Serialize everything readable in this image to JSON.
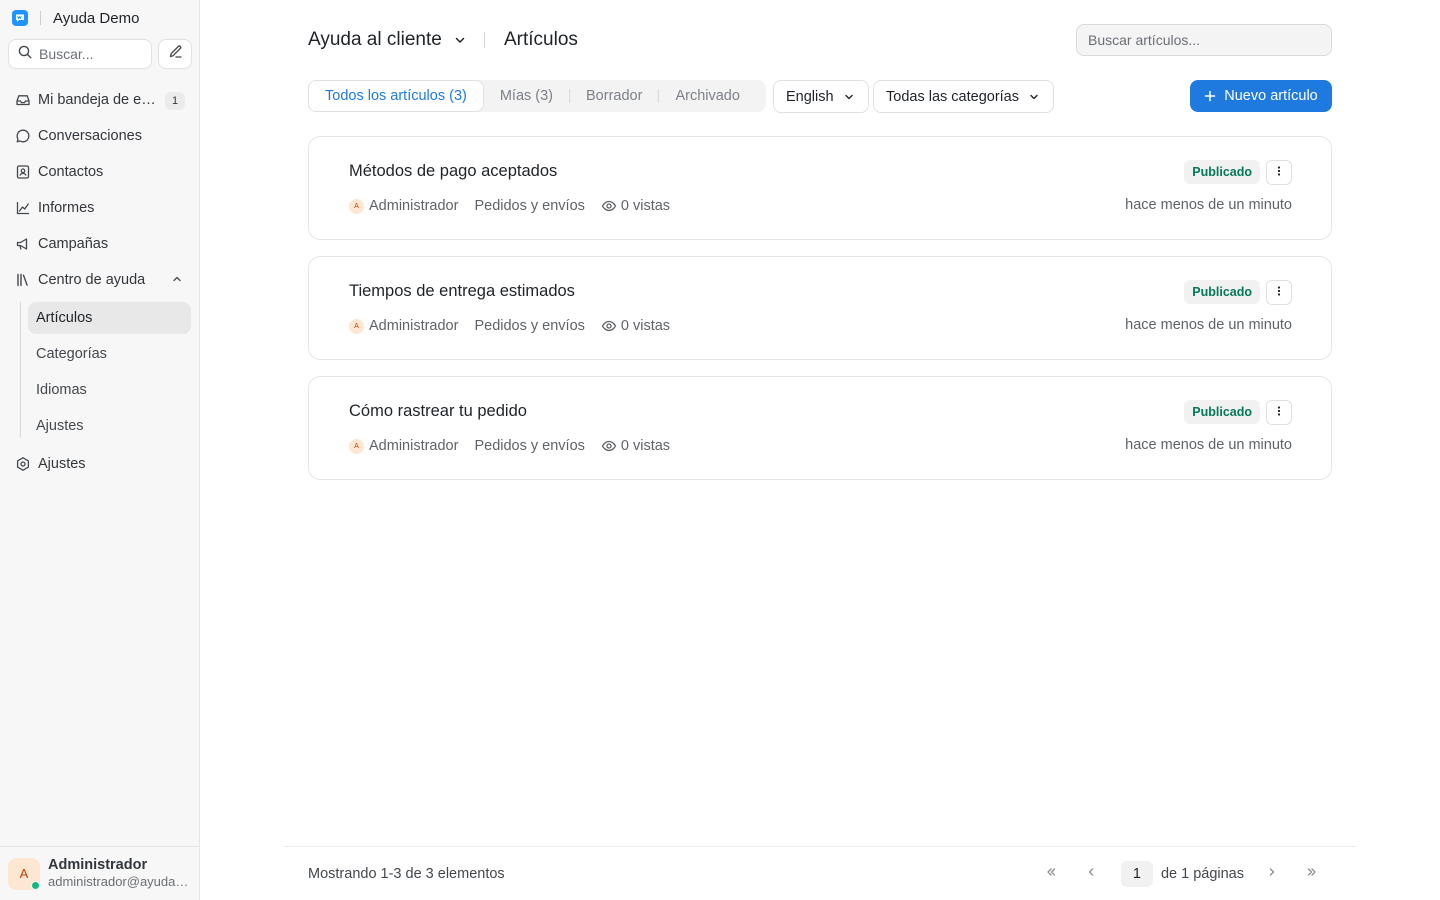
{
  "app": {
    "name": "Ayuda Demo"
  },
  "sidebar": {
    "search_placeholder": "Buscar...",
    "items": [
      {
        "label": "Mi bandeja de entrada",
        "icon": "inbox-icon",
        "badge": "1"
      },
      {
        "label": "Conversaciones",
        "icon": "chat-bubble-icon"
      },
      {
        "label": "Contactos",
        "icon": "contact-card-icon"
      },
      {
        "label": "Informes",
        "icon": "line-chart-icon"
      },
      {
        "label": "Campañas",
        "icon": "megaphone-icon"
      },
      {
        "label": "Centro de ayuda",
        "icon": "library-icon"
      }
    ],
    "help_center_subitems": [
      {
        "label": "Artículos",
        "active": true
      },
      {
        "label": "Categorías"
      },
      {
        "label": "Idiomas"
      },
      {
        "label": "Ajustes"
      }
    ],
    "settings": {
      "label": "Ajustes",
      "icon": "settings-icon"
    }
  },
  "user": {
    "initial": "A",
    "name": "Administrador",
    "email": "administrador@ayudademo.com",
    "status": "online"
  },
  "header": {
    "portal": "Ayuda al cliente",
    "section": "Artículos",
    "search_placeholder": "Buscar artículos..."
  },
  "tabs": [
    {
      "label": "Todos los artículos (3)",
      "active": true
    },
    {
      "label": "Mías (3)"
    },
    {
      "label": "Borrador"
    },
    {
      "label": "Archivado"
    }
  ],
  "filters": {
    "locale": "English",
    "category": "Todas las categorías"
  },
  "new_article_label": "Nuevo artículo",
  "articles": [
    {
      "title": "Métodos de pago aceptados",
      "status": "Publicado",
      "author_initial": "A",
      "author": "Administrador",
      "category": "Pedidos y envíos",
      "views": "0 vistas",
      "updated": "hace menos de un minuto"
    },
    {
      "title": "Tiempos de entrega estimados",
      "status": "Publicado",
      "author_initial": "A",
      "author": "Administrador",
      "category": "Pedidos y envíos",
      "views": "0 vistas",
      "updated": "hace menos de un minuto"
    },
    {
      "title": "Cómo rastrear tu pedido",
      "status": "Publicado",
      "author_initial": "A",
      "author": "Administrador",
      "category": "Pedidos y envíos",
      "views": "0 vistas",
      "updated": "hace menos de un minuto"
    }
  ],
  "pagination": {
    "summary": "Mostrando 1-3 de 3 elementos",
    "current_page": "1",
    "of_pages": "de 1 páginas"
  },
  "colors": {
    "primary": "#1f7ae0",
    "brand": "#1f93ff",
    "published_text": "#047857",
    "online": "#10b981"
  }
}
